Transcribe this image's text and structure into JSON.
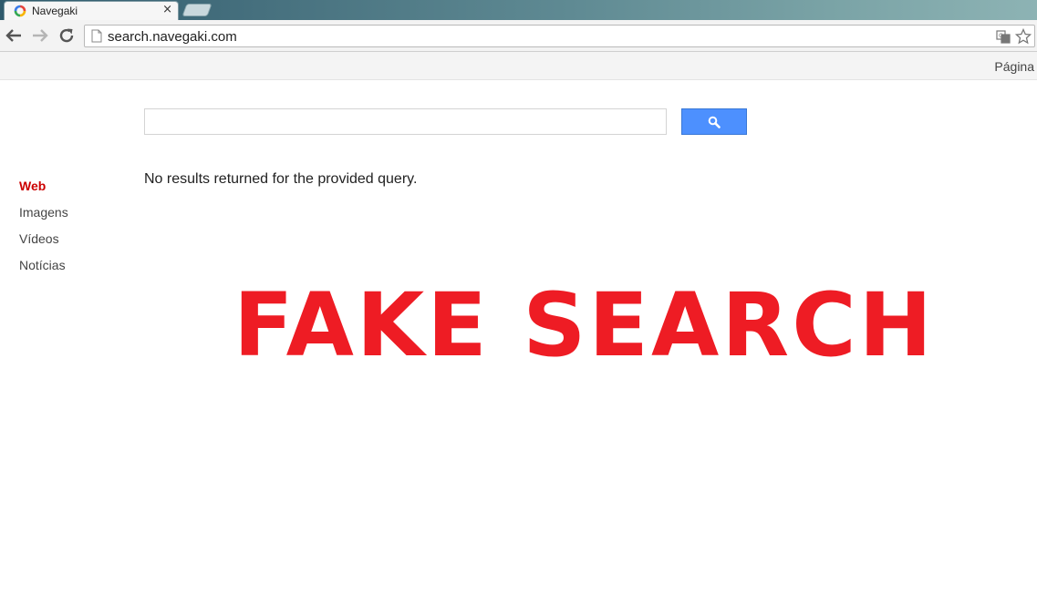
{
  "browser": {
    "tab": {
      "title": "Navegaki",
      "close_glyph": "×",
      "favicon": "navegaki-logo-icon"
    },
    "address_bar": {
      "url": "search.navegaki.com"
    },
    "icons": [
      "back-arrow-icon",
      "forward-arrow-icon",
      "reload-icon",
      "page-icon",
      "translate-icon",
      "star-icon"
    ],
    "menu_link": "Página"
  },
  "search": {
    "query": "",
    "button_icon": "magnifier-icon",
    "accent_color": "#4d90fe"
  },
  "sidebar": {
    "items": [
      {
        "label": "Web",
        "active": true
      },
      {
        "label": "Imagens",
        "active": false
      },
      {
        "label": "Vídeos",
        "active": false
      },
      {
        "label": "Notícias",
        "active": false
      }
    ],
    "active_color": "#cc0000"
  },
  "results": {
    "message": "No results returned for the provided query."
  },
  "overlay": {
    "text": "FAKE SEARCH",
    "color": "#ee1c24"
  }
}
